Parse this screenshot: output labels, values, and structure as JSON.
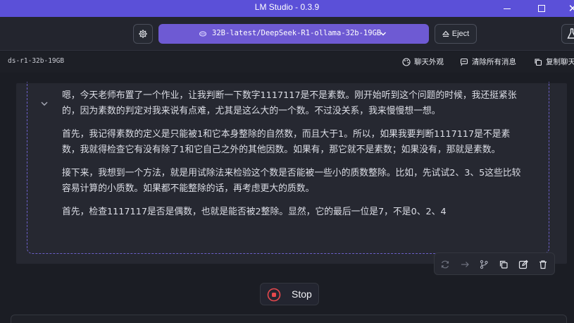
{
  "window": {
    "title": "LM Studio - 0.3.9"
  },
  "toolbar": {
    "model_label": "32B-latest/DeepSeek-R1-ollama-32b-19GB",
    "eject_label": "Eject"
  },
  "subheader": {
    "model_id": "ds-r1-32b-19GB",
    "appearance_label": "聊天外观",
    "clear_label": "清除所有消息",
    "copy_label": "复制聊天"
  },
  "thinking": {
    "paragraphs": [
      "嗯，今天老师布置了一个作业，让我判断一下数字1117117是不是素数。刚开始听到这个问题的时候，我还挺紧张的，因为素数的判定对我来说有点难，尤其是这么大的一个数。不过没关系，我来慢慢想一想。",
      "首先，我记得素数的定义是只能被1和它本身整除的自然数，而且大于1。所以，如果我要判断1117117是不是素数，我就得检查它有没有除了1和它自己之外的其他因数。如果有，那它就不是素数；如果没有，那就是素数。",
      "接下来，我想到一个方法，就是用试除法来检验这个数是否能被一些小的质数整除。比如，先试试2、3、5这些比较容易计算的小质数。如果都不能整除的话，再考虑更大的质数。",
      "首先，检查1117117是否是偶数，也就是能否被2整除。显然，它的最后一位是7，不是0、2、4"
    ]
  },
  "stop": {
    "label": "Stop"
  },
  "colors": {
    "accent": "#6e5ad3",
    "titlebar": "#5b50d8",
    "stop_red": "#e5484d"
  }
}
